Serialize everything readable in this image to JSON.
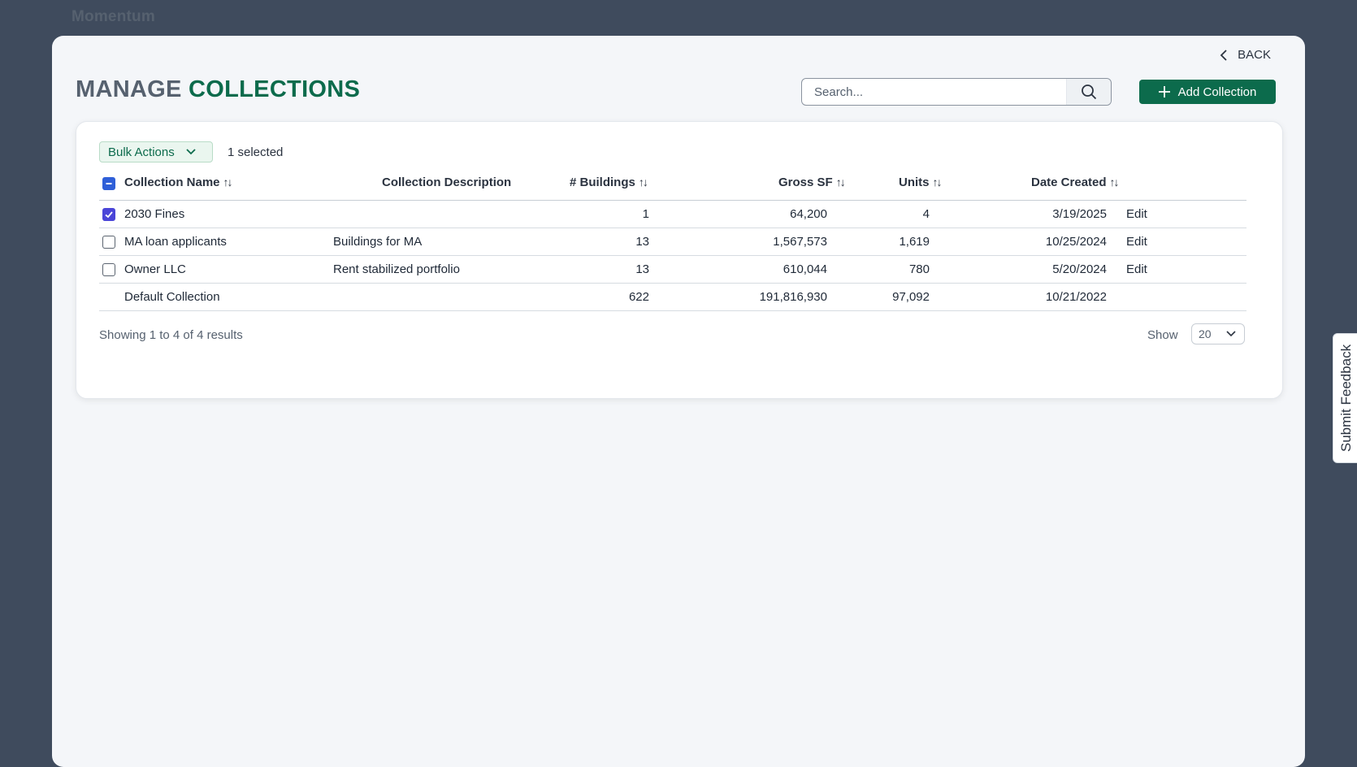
{
  "app": {
    "brand": "Momentum"
  },
  "nav": {
    "back_label": "BACK"
  },
  "header": {
    "title_part1": "MANAGE",
    "title_part2": "COLLECTIONS",
    "search_placeholder": "Search...",
    "add_button_label": "Add Collection"
  },
  "toolbar": {
    "bulk_actions_label": "Bulk Actions",
    "selected_count": "1 selected"
  },
  "table": {
    "columns": {
      "name": "Collection Name",
      "description": "Collection Description",
      "buildings": "# Buildings",
      "gross_sf": "Gross SF",
      "units": "Units",
      "date_created": "Date Created"
    },
    "sort_glyph": "↑↓",
    "rows": [
      {
        "checked": true,
        "name": "2030 Fines",
        "description": "",
        "buildings": "1",
        "gross_sf": "64,200",
        "units": "4",
        "date": "3/19/2025",
        "action": "Edit"
      },
      {
        "checked": false,
        "name": "MA loan applicants",
        "description": "Buildings for MA",
        "buildings": "13",
        "gross_sf": "1,567,573",
        "units": "1,619",
        "date": "10/25/2024",
        "action": "Edit"
      },
      {
        "checked": false,
        "name": "Owner LLC",
        "description": "Rent stabilized portfolio",
        "buildings": "13",
        "gross_sf": "610,044",
        "units": "780",
        "date": "5/20/2024",
        "action": "Edit"
      },
      {
        "checked": null,
        "name": "Default Collection",
        "description": "",
        "buildings": "622",
        "gross_sf": "191,816,930",
        "units": "97,092",
        "date": "10/21/2022",
        "action": ""
      }
    ]
  },
  "footer": {
    "results_text": "Showing 1 to 4 of 4 results",
    "show_label": "Show",
    "page_size": "20"
  },
  "feedback": {
    "label": "Submit Feedback"
  },
  "colors": {
    "brand_green": "#0c6b4c",
    "background": "#3f4b5d",
    "checkbox_checked": "#4a45d8",
    "checkbox_indeterminate": "#2f5fd8"
  }
}
